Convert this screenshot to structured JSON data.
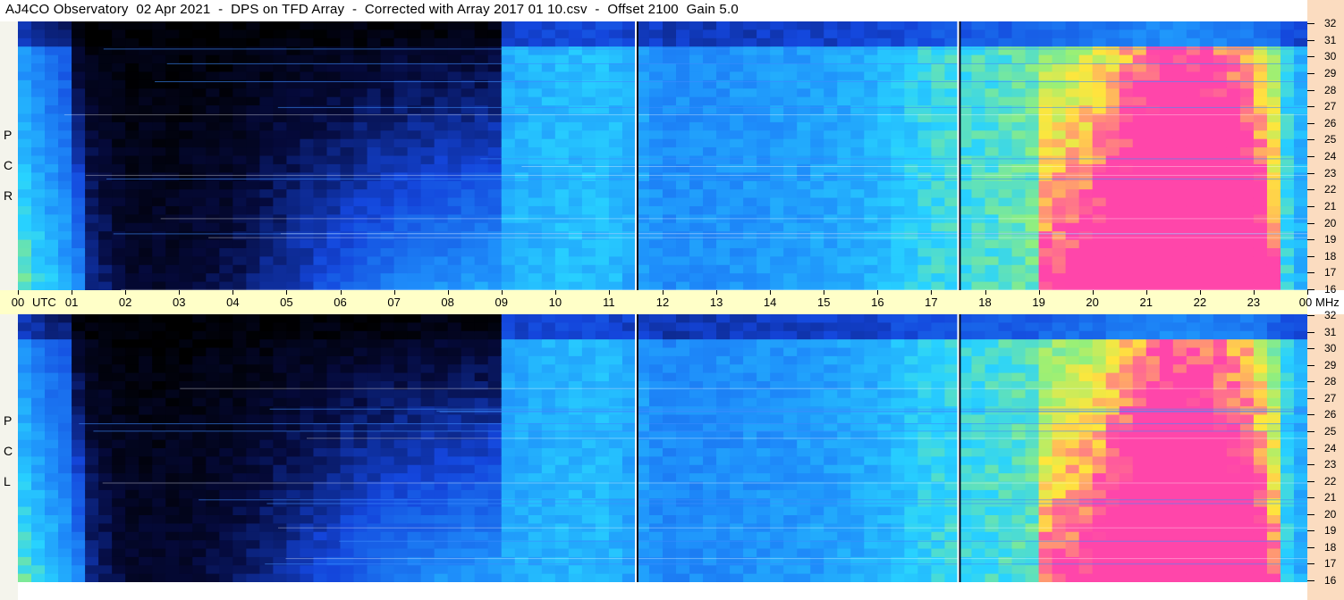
{
  "title": "AJ4CO Observatory  02 Apr 2021  -  DPS on TFD Array  -  Corrected with Array 2017 01 10.csv  -  Offset 2100  Gain 5.0",
  "panels": [
    {
      "id": "rcp",
      "letters": [
        "R",
        "C",
        "P"
      ]
    },
    {
      "id": "lcp",
      "letters": [
        "L",
        "C",
        "P"
      ]
    }
  ],
  "utc_label": "UTC",
  "mhz_label": "MHz",
  "colors": {
    "background": "#000000",
    "low": "#0a1a6e",
    "mid": "#1e6cf0",
    "high": "#22d2ff",
    "hot": "#ffe040",
    "peak": "#ff40a0",
    "time_band": "#ffffc8",
    "freq_axis": "#fbdcc0"
  },
  "chart_data": {
    "type": "heatmap",
    "title": "AJ4CO Observatory  02 Apr 2021  -  DPS on TFD Array  -  Corrected with Array 2017 01 10.csv  -  Offset 2100  Gain 5.0",
    "xlabel": "UTC",
    "ylabel": "MHz",
    "x_ticks": [
      "00",
      "01",
      "02",
      "03",
      "04",
      "05",
      "06",
      "07",
      "08",
      "09",
      "10",
      "11",
      "12",
      "13",
      "14",
      "15",
      "16",
      "17",
      "18",
      "19",
      "20",
      "21",
      "22",
      "23",
      "00"
    ],
    "xlim_hours": [
      0,
      24
    ],
    "y_ticks": [
      "16",
      "17",
      "18",
      "19",
      "20",
      "21",
      "22",
      "23",
      "24",
      "25",
      "26",
      "27",
      "28",
      "29",
      "30",
      "31",
      "32"
    ],
    "ylim_mhz": [
      16,
      32
    ],
    "vertical_markers_utc": [
      11.5,
      17.5
    ],
    "panels": [
      "R C P",
      "L C P"
    ],
    "description": [],
    "intensity_profile_by_hour": [
      0.55,
      0.35,
      0.12,
      0.12,
      0.18,
      0.3,
      0.42,
      0.52,
      0.58,
      0.62,
      0.65,
      0.66,
      0.55,
      0.56,
      0.58,
      0.6,
      0.64,
      0.72,
      0.74,
      0.78,
      0.84,
      0.95,
      0.98,
      0.9,
      0.6
    ]
  }
}
